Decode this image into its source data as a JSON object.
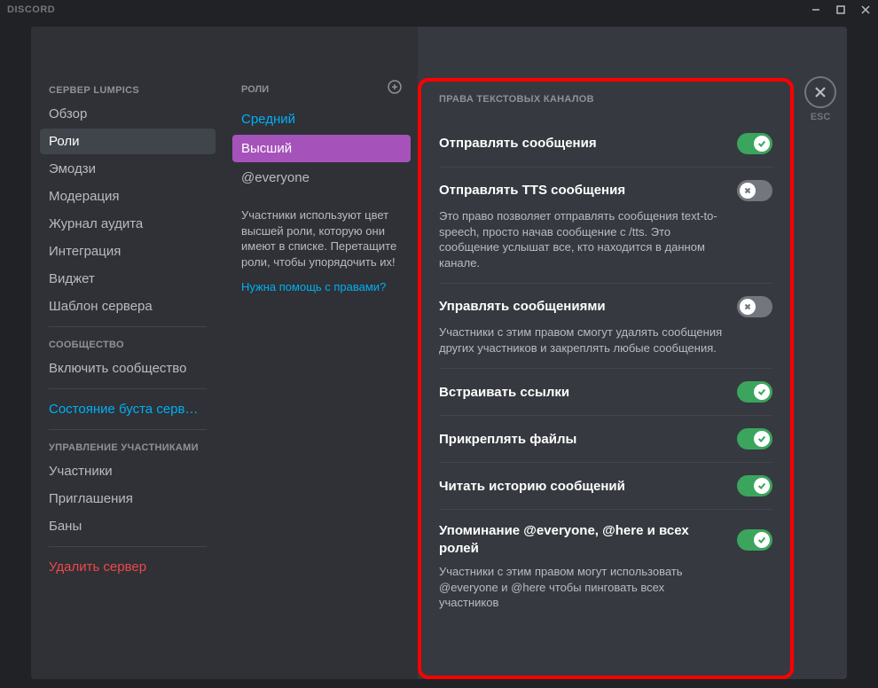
{
  "titlebar": {
    "title": "DISCORD"
  },
  "sidebar": {
    "cat1": "СЕРВЕР LUMPICS",
    "items1": [
      "Обзор",
      "Роли",
      "Эмодзи",
      "Модерация",
      "Журнал аудита",
      "Интеграция",
      "Виджет",
      "Шаблон сервера"
    ],
    "cat2": "СООБЩЕСТВО",
    "items2": [
      "Включить сообщество"
    ],
    "boost": "Состояние буста серв…",
    "cat3": "УПРАВЛЕНИЕ УЧАСТНИКАМИ",
    "items3": [
      "Участники",
      "Приглашения",
      "Баны"
    ],
    "delete": "Удалить сервер"
  },
  "roles": {
    "title": "РОЛИ",
    "list": [
      {
        "label": "Средний",
        "color": "blue"
      },
      {
        "label": "Высший",
        "color": "purple",
        "active": true
      },
      {
        "label": "@everyone",
        "color": "everyone"
      }
    ],
    "hint": "Участники используют цвет высшей роли, которую они имеют в списке. Перетащите роли, чтобы упорядочить их!",
    "help": "Нужна помощь с правами?"
  },
  "permissions": {
    "section_title": "ПРАВА ТЕКСТОВЫХ КАНАЛОВ",
    "rows": [
      {
        "label": "Отправлять сообщения",
        "on": true
      },
      {
        "label": "Отправлять TTS сообщения",
        "on": false,
        "desc": "Это право позволяет отправлять сообщения text-to-speech, просто начав сообщение с /tts. Это сообщение услышат все, кто находится в данном канале."
      },
      {
        "label": "Управлять сообщениями",
        "on": false,
        "desc": "Участники с этим правом смогут удалять сообщения других участников и закреплять любые сообщения."
      },
      {
        "label": "Встраивать ссылки",
        "on": true
      },
      {
        "label": "Прикреплять файлы",
        "on": true
      },
      {
        "label": "Читать историю сообщений",
        "on": true
      },
      {
        "label": "Упоминание @everyone, @here и всех ролей",
        "on": true,
        "desc": "Участники с этим правом могут использовать @everyone и @here чтобы пинговать всех участников"
      }
    ]
  },
  "close": {
    "label": "ESC"
  }
}
